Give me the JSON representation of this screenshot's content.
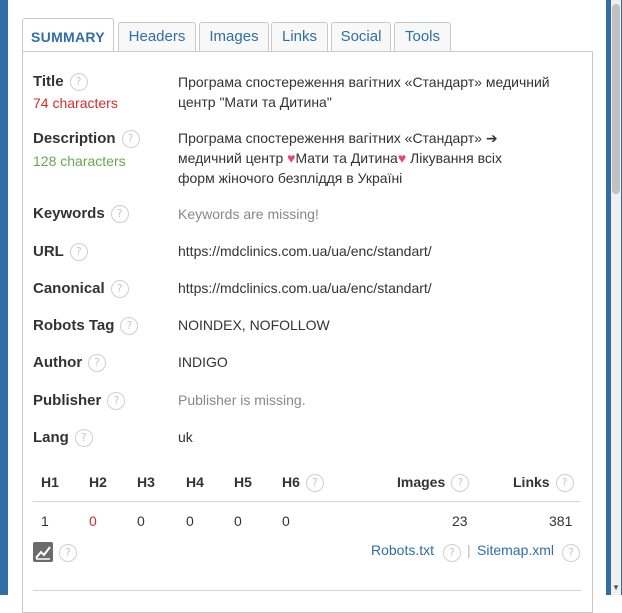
{
  "tabs": [
    {
      "label": "SUMMARY"
    },
    {
      "label": "Headers"
    },
    {
      "label": "Images"
    },
    {
      "label": "Links"
    },
    {
      "label": "Social"
    },
    {
      "label": "Tools"
    }
  ],
  "help_glyph": "?",
  "rows": {
    "title": {
      "label": "Title",
      "sub": "74 characters",
      "value_line1": "Програма спостереження вагітних «Стандарт» медичний",
      "value_line2": "центр \"Мати та Дитина\""
    },
    "description": {
      "label": "Description",
      "sub": "128 characters",
      "value_line1": "Програма спостереження вагітних «Стандарт» ➔",
      "value_line2a": "медичний центр ",
      "value_line2b": "Мати та Дитина",
      "value_line2c": " Лікування всіх",
      "value_line3": "форм жіночого безпліддя в Україні",
      "heart": "♥"
    },
    "keywords": {
      "label": "Keywords",
      "value": "Keywords are missing!"
    },
    "url": {
      "label": "URL",
      "value": "https://mdclinics.com.ua/ua/enc/standart/"
    },
    "canonical": {
      "label": "Canonical",
      "value": "https://mdclinics.com.ua/ua/enc/standart/"
    },
    "robots": {
      "label": "Robots Tag",
      "value": "NOINDEX, NOFOLLOW"
    },
    "author": {
      "label": "Author",
      "value": "INDIGO"
    },
    "publisher": {
      "label": "Publisher",
      "value": "Publisher is missing."
    },
    "lang": {
      "label": "Lang",
      "value": "uk"
    }
  },
  "headings_table": {
    "headers": [
      "H1",
      "H2",
      "H3",
      "H4",
      "H5",
      "H6",
      "Images",
      "Links"
    ],
    "values": [
      "1",
      "0",
      "0",
      "0",
      "0",
      "0",
      "23",
      "381"
    ]
  },
  "footer": {
    "robots_link": "Robots.txt",
    "separator": "|",
    "sitemap_link": "Sitemap.xml"
  },
  "colors": {
    "accent": "#2f6ea7",
    "warning": "#d72c2c",
    "ok": "#6aa84f",
    "heart": "#e04a7a"
  }
}
